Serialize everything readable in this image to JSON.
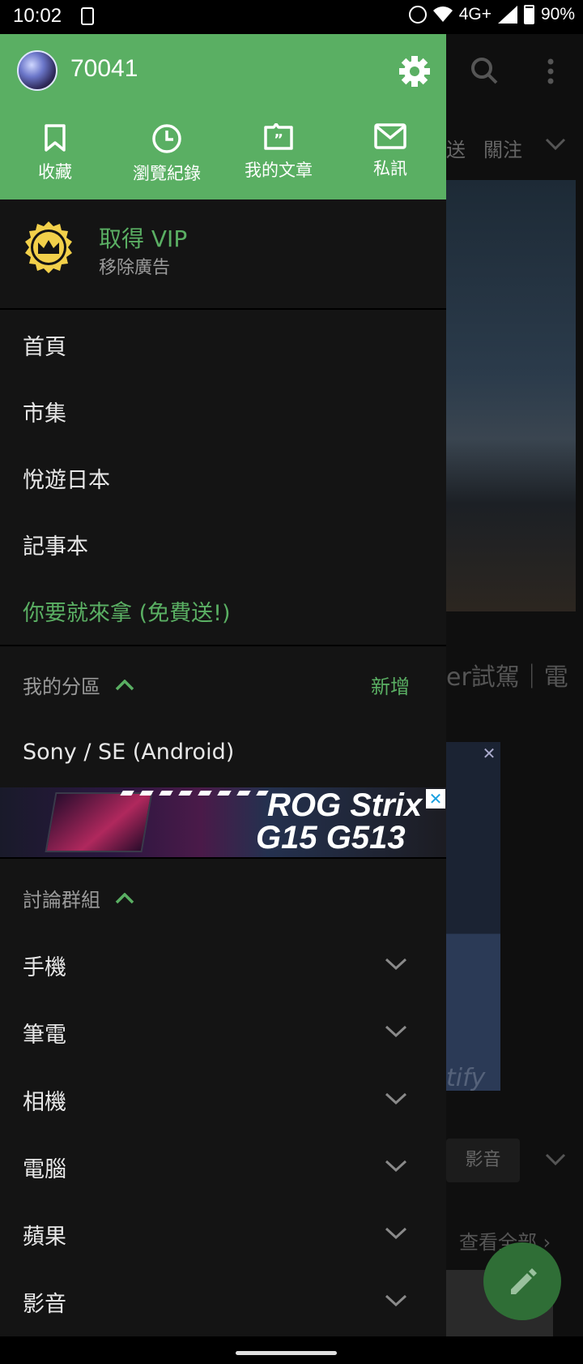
{
  "status_bar": {
    "time": "10:02",
    "network": "4G+",
    "battery": "90%"
  },
  "drawer": {
    "username": "70041",
    "quick_actions": [
      {
        "label": "收藏",
        "icon": "bookmark-icon"
      },
      {
        "label": "瀏覽紀錄",
        "icon": "clock-icon"
      },
      {
        "label": "我的文章",
        "icon": "quote-icon"
      },
      {
        "label": "私訊",
        "icon": "mail-icon"
      }
    ],
    "vip": {
      "title": "取得 VIP",
      "subtitle": "移除廣告"
    },
    "menu": [
      {
        "label": "首頁"
      },
      {
        "label": "市集"
      },
      {
        "label": "悅遊日本"
      },
      {
        "label": "記事本"
      },
      {
        "label": "你要就來拿 (免費送!)"
      }
    ],
    "my_section": {
      "title": "我的分區",
      "add_label": "新增",
      "items": [
        "Sony / SE (Android)"
      ]
    },
    "ad_banner": {
      "line1": "ROG Strix",
      "line2": "G15 G513"
    },
    "groups_section": {
      "title": "討論群組",
      "items": [
        "手機",
        "筆電",
        "相機",
        "電腦",
        "蘋果",
        "影音"
      ]
    }
  },
  "background_app": {
    "tab_partial": "送",
    "tab_follow": "關注",
    "title_fragment": "er試駕｜電",
    "ad_text_fragment": "tify",
    "chip": "影音",
    "see_all": "查看全部 ›"
  },
  "colors": {
    "accent": "#5aaf63",
    "drawer_bg": "#141414",
    "header_bg": "#5aaf63"
  }
}
